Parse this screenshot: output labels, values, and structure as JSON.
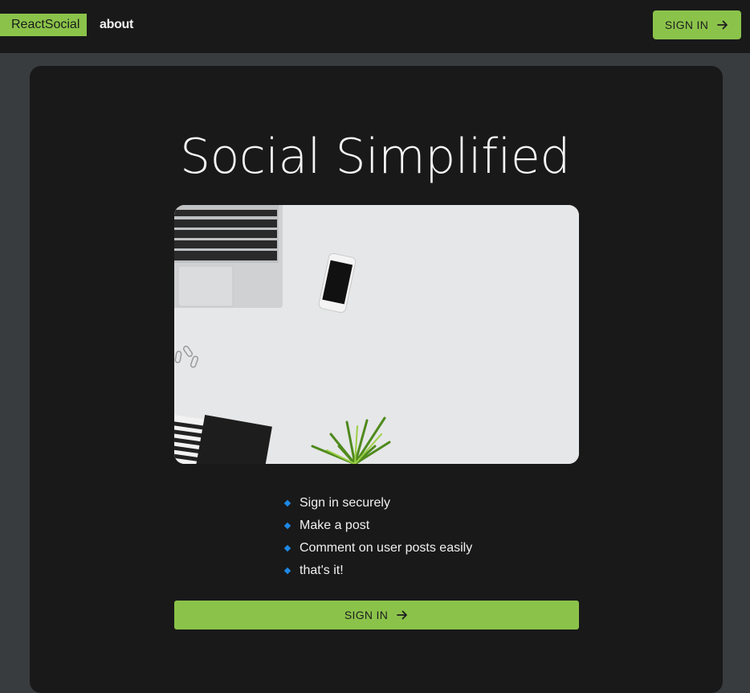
{
  "header": {
    "brand": "ReactSocial",
    "nav_about": "about",
    "signin_label": "SIGN IN",
    "signin_icon": "arrow-right-icon"
  },
  "main": {
    "headline": "Social Simplified",
    "hero_image": "desk-workspace-photo",
    "features": [
      "Sign in securely",
      "Make a post",
      "Comment on user posts easily",
      "that's it!"
    ],
    "signin_label": "SIGN IN",
    "signin_icon": "arrow-right-icon"
  },
  "colors": {
    "accent": "#8bc34a",
    "bullet": "#1e88e5",
    "panel": "#191919",
    "page_bg": "#383c3f"
  }
}
